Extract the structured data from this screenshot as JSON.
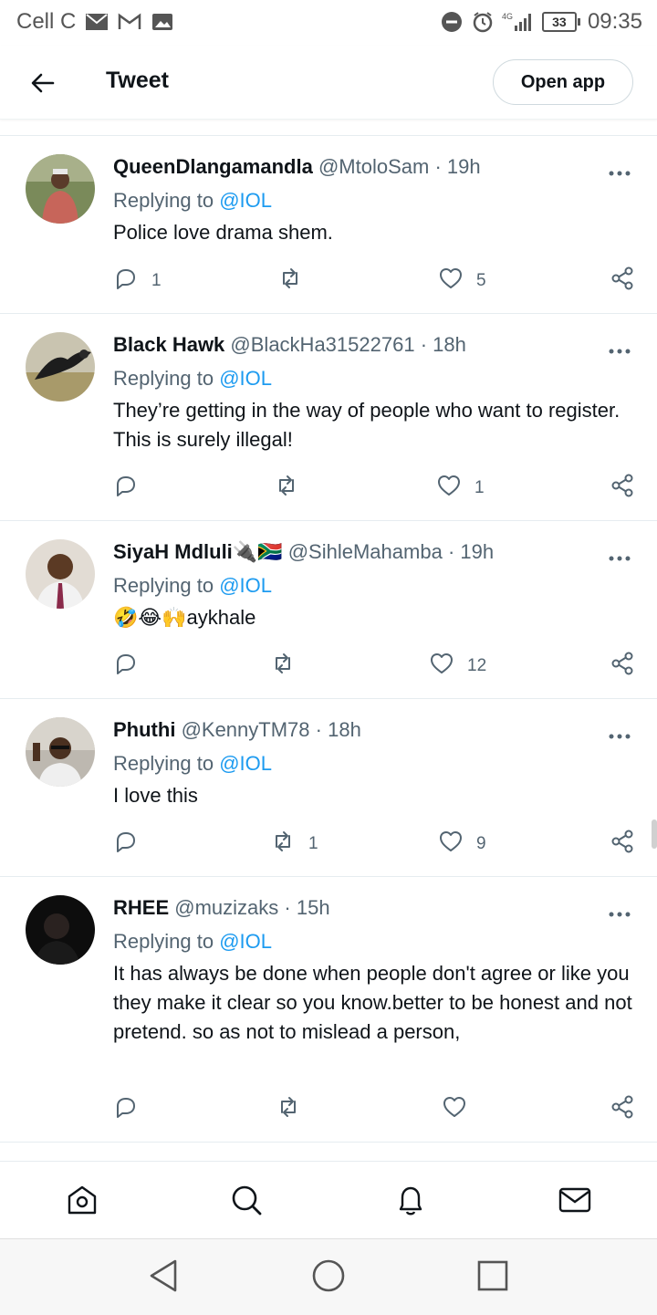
{
  "status_bar": {
    "carrier": "Cell C",
    "network": "4G",
    "battery": "33",
    "time": "09:35"
  },
  "header": {
    "title": "Tweet",
    "open_app": "Open app"
  },
  "tweets": [
    {
      "name": "QueenDlangamandla",
      "handle": "@MtoloSam",
      "time": "19h",
      "replying_prefix": "Replying to",
      "replying_to": "@IOL",
      "text": "Police love drama shem.",
      "replies": "1",
      "retweets": "",
      "likes": "5"
    },
    {
      "name": "Black Hawk",
      "handle": "@BlackHa31522761",
      "time": "18h",
      "replying_prefix": "Replying to",
      "replying_to": "@IOL",
      "text": "They’re getting in the way of people who want to register. This is surely illegal!",
      "replies": "",
      "retweets": "",
      "likes": "1"
    },
    {
      "name": "SiyaH Mdluli🔌🇿🇦",
      "handle": "@SihleMahamba",
      "time": "19h",
      "replying_prefix": "Replying to",
      "replying_to": "@IOL",
      "text": "🤣😂🙌aykhale",
      "replies": "",
      "retweets": "",
      "likes": "12"
    },
    {
      "name": "Phuthi",
      "handle": "@KennyTM78",
      "time": "18h",
      "replying_prefix": "Replying to",
      "replying_to": "@IOL",
      "text": "I love this",
      "replies": "",
      "retweets": "1",
      "likes": "9"
    },
    {
      "name": "RHEE",
      "handle": "@muzizaks",
      "time": "15h",
      "replying_prefix": "Replying to",
      "replying_to": "@IOL",
      "text": "It has always be done when people don't agree or like you they make  it  clear so you know.better to be honest and not pretend. so as not to mislead a person,",
      "replies": "",
      "retweets": "",
      "likes": ""
    }
  ],
  "bottom_nav": [
    "home-icon",
    "search-icon",
    "notifications-icon",
    "messages-icon"
  ],
  "system_nav": [
    "back-icon",
    "home-icon",
    "recents-icon"
  ],
  "colors": {
    "accent": "#1d9bf0",
    "text": "#0f1419",
    "muted": "#536471"
  }
}
